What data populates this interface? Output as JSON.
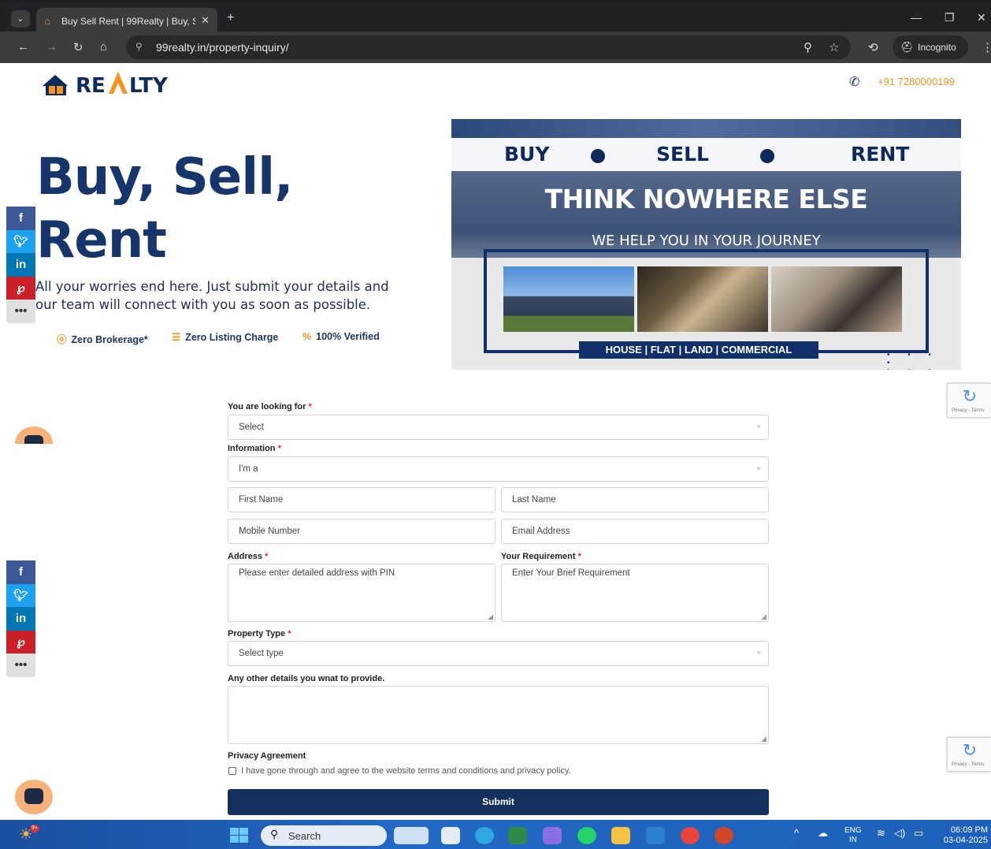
{
  "browser": {
    "tab_title": "Buy Sell Rent | 99Realty | Buy, S",
    "new_tab": "+",
    "url_site_icon": "⚲",
    "url": "99realty.in/property-inquiry/",
    "profile": "Incognito"
  },
  "header": {
    "logo_text": "RE LTY",
    "phone": "+91 7280000199"
  },
  "hero": {
    "title_line1": "Buy, Sell,",
    "title_line2": "Rent",
    "subtitle": "All your worries end here. Just submit your details and our team will connect with you as soon as possible.",
    "features": [
      {
        "icon": "ⓞ",
        "label": "Zero Brokerage*"
      },
      {
        "icon": "☰",
        "label": "Zero Listing Charge"
      },
      {
        "icon": "%",
        "label": "100% Verified"
      }
    ]
  },
  "banner": {
    "buy": "BUY",
    "sell": "SELL",
    "rent": "RENT",
    "headline": "THINK NOWHERE ELSE",
    "subline": "WE HELP YOU IN YOUR JOURNEY",
    "caption": "HOUSE | FLAT | LAND | COMMERCIAL"
  },
  "recaptcha": {
    "text": "Privacy - Terms"
  },
  "form": {
    "looking_for_label": "You are looking for",
    "looking_for_value": "Select",
    "information_label": "Information",
    "information_value": "I'm a",
    "first_name_placeholder": "First Name",
    "last_name_placeholder": "Last Name",
    "mobile_placeholder": "Mobile Number",
    "email_placeholder": "Email Address",
    "address_label": "Address",
    "address_placeholder": "Please enter detailed address with PIN",
    "requirement_label": "Your Requirement",
    "requirement_placeholder": "Enter Your Brief Requirement",
    "property_type_label": "Property Type",
    "property_type_value": "Select type",
    "other_details_label": "Any other details you wnat to provide.",
    "privacy_label": "Privacy Agreement",
    "privacy_text": "I have gone through and agree to the website terms and conditions and privacy policy.",
    "required_mark": "*",
    "submit_label": "Submit"
  },
  "taskbar": {
    "weather_badge": "9+",
    "search_label": "Search",
    "lang_line1": "ENG",
    "lang_line2": "IN",
    "time": "06:09 PM",
    "date": "03-04-2025"
  }
}
